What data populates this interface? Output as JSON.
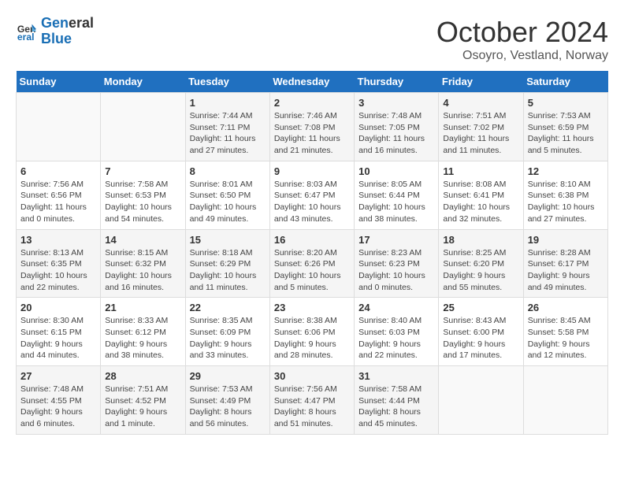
{
  "header": {
    "logo_line1": "General",
    "logo_line2": "Blue",
    "month": "October 2024",
    "location": "Osoyro, Vestland, Norway"
  },
  "weekdays": [
    "Sunday",
    "Monday",
    "Tuesday",
    "Wednesday",
    "Thursday",
    "Friday",
    "Saturday"
  ],
  "weeks": [
    [
      {
        "day": "",
        "info": ""
      },
      {
        "day": "",
        "info": ""
      },
      {
        "day": "1",
        "info": "Sunrise: 7:44 AM\nSunset: 7:11 PM\nDaylight: 11 hours and 27 minutes."
      },
      {
        "day": "2",
        "info": "Sunrise: 7:46 AM\nSunset: 7:08 PM\nDaylight: 11 hours and 21 minutes."
      },
      {
        "day": "3",
        "info": "Sunrise: 7:48 AM\nSunset: 7:05 PM\nDaylight: 11 hours and 16 minutes."
      },
      {
        "day": "4",
        "info": "Sunrise: 7:51 AM\nSunset: 7:02 PM\nDaylight: 11 hours and 11 minutes."
      },
      {
        "day": "5",
        "info": "Sunrise: 7:53 AM\nSunset: 6:59 PM\nDaylight: 11 hours and 5 minutes."
      }
    ],
    [
      {
        "day": "6",
        "info": "Sunrise: 7:56 AM\nSunset: 6:56 PM\nDaylight: 11 hours and 0 minutes."
      },
      {
        "day": "7",
        "info": "Sunrise: 7:58 AM\nSunset: 6:53 PM\nDaylight: 10 hours and 54 minutes."
      },
      {
        "day": "8",
        "info": "Sunrise: 8:01 AM\nSunset: 6:50 PM\nDaylight: 10 hours and 49 minutes."
      },
      {
        "day": "9",
        "info": "Sunrise: 8:03 AM\nSunset: 6:47 PM\nDaylight: 10 hours and 43 minutes."
      },
      {
        "day": "10",
        "info": "Sunrise: 8:05 AM\nSunset: 6:44 PM\nDaylight: 10 hours and 38 minutes."
      },
      {
        "day": "11",
        "info": "Sunrise: 8:08 AM\nSunset: 6:41 PM\nDaylight: 10 hours and 32 minutes."
      },
      {
        "day": "12",
        "info": "Sunrise: 8:10 AM\nSunset: 6:38 PM\nDaylight: 10 hours and 27 minutes."
      }
    ],
    [
      {
        "day": "13",
        "info": "Sunrise: 8:13 AM\nSunset: 6:35 PM\nDaylight: 10 hours and 22 minutes."
      },
      {
        "day": "14",
        "info": "Sunrise: 8:15 AM\nSunset: 6:32 PM\nDaylight: 10 hours and 16 minutes."
      },
      {
        "day": "15",
        "info": "Sunrise: 8:18 AM\nSunset: 6:29 PM\nDaylight: 10 hours and 11 minutes."
      },
      {
        "day": "16",
        "info": "Sunrise: 8:20 AM\nSunset: 6:26 PM\nDaylight: 10 hours and 5 minutes."
      },
      {
        "day": "17",
        "info": "Sunrise: 8:23 AM\nSunset: 6:23 PM\nDaylight: 10 hours and 0 minutes."
      },
      {
        "day": "18",
        "info": "Sunrise: 8:25 AM\nSunset: 6:20 PM\nDaylight: 9 hours and 55 minutes."
      },
      {
        "day": "19",
        "info": "Sunrise: 8:28 AM\nSunset: 6:17 PM\nDaylight: 9 hours and 49 minutes."
      }
    ],
    [
      {
        "day": "20",
        "info": "Sunrise: 8:30 AM\nSunset: 6:15 PM\nDaylight: 9 hours and 44 minutes."
      },
      {
        "day": "21",
        "info": "Sunrise: 8:33 AM\nSunset: 6:12 PM\nDaylight: 9 hours and 38 minutes."
      },
      {
        "day": "22",
        "info": "Sunrise: 8:35 AM\nSunset: 6:09 PM\nDaylight: 9 hours and 33 minutes."
      },
      {
        "day": "23",
        "info": "Sunrise: 8:38 AM\nSunset: 6:06 PM\nDaylight: 9 hours and 28 minutes."
      },
      {
        "day": "24",
        "info": "Sunrise: 8:40 AM\nSunset: 6:03 PM\nDaylight: 9 hours and 22 minutes."
      },
      {
        "day": "25",
        "info": "Sunrise: 8:43 AM\nSunset: 6:00 PM\nDaylight: 9 hours and 17 minutes."
      },
      {
        "day": "26",
        "info": "Sunrise: 8:45 AM\nSunset: 5:58 PM\nDaylight: 9 hours and 12 minutes."
      }
    ],
    [
      {
        "day": "27",
        "info": "Sunrise: 7:48 AM\nSunset: 4:55 PM\nDaylight: 9 hours and 6 minutes."
      },
      {
        "day": "28",
        "info": "Sunrise: 7:51 AM\nSunset: 4:52 PM\nDaylight: 9 hours and 1 minute."
      },
      {
        "day": "29",
        "info": "Sunrise: 7:53 AM\nSunset: 4:49 PM\nDaylight: 8 hours and 56 minutes."
      },
      {
        "day": "30",
        "info": "Sunrise: 7:56 AM\nSunset: 4:47 PM\nDaylight: 8 hours and 51 minutes."
      },
      {
        "day": "31",
        "info": "Sunrise: 7:58 AM\nSunset: 4:44 PM\nDaylight: 8 hours and 45 minutes."
      },
      {
        "day": "",
        "info": ""
      },
      {
        "day": "",
        "info": ""
      }
    ]
  ]
}
